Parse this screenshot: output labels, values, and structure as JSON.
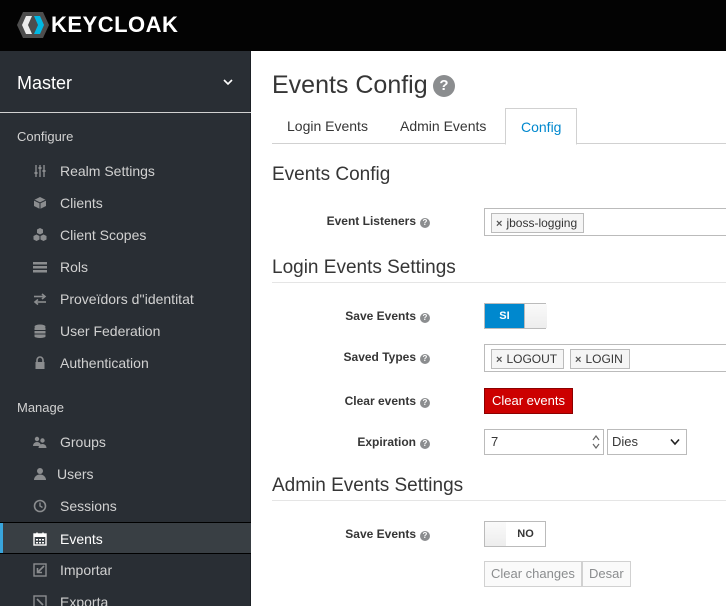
{
  "header": {
    "brand": "KEYCLOAK"
  },
  "sidebar": {
    "realm": "Master",
    "configure_label": "Configure",
    "manage_label": "Manage",
    "configure_items": [
      {
        "label": "Realm Settings",
        "icon": "sliders-icon"
      },
      {
        "label": "Clients",
        "icon": "cube-icon"
      },
      {
        "label": "Client Scopes",
        "icon": "cubes-icon"
      },
      {
        "label": "Rols",
        "icon": "list-icon"
      },
      {
        "label": "Proveïdors d''identitat",
        "icon": "exchange-icon"
      },
      {
        "label": "User Federation",
        "icon": "database-icon"
      },
      {
        "label": "Authentication",
        "icon": "lock-icon"
      }
    ],
    "manage_items": [
      {
        "label": "Groups",
        "icon": "users-icon"
      },
      {
        "label": "Users",
        "icon": "user-icon"
      },
      {
        "label": "Sessions",
        "icon": "clock-icon"
      },
      {
        "label": "Events",
        "icon": "calendar-icon",
        "active": true
      },
      {
        "label": "Importar",
        "icon": "import-icon"
      },
      {
        "label": "Exporta",
        "icon": "export-icon"
      }
    ]
  },
  "main": {
    "title": "Events Config",
    "tabs": [
      {
        "label": "Login Events"
      },
      {
        "label": "Admin Events"
      },
      {
        "label": "Config",
        "active": true
      }
    ],
    "events_config_title": "Events Config",
    "event_listeners_label": "Event Listeners",
    "event_listeners": [
      "jboss-logging"
    ],
    "login_settings_title": "Login Events Settings",
    "login_save_events_label": "Save Events",
    "login_save_events_state": "SI",
    "saved_types_label": "Saved Types",
    "saved_types": [
      "LOGOUT",
      "LOGIN"
    ],
    "clear_events_label": "Clear events",
    "clear_events_button": "Clear events",
    "expiration_label": "Expiration",
    "expiration_value": "7",
    "expiration_unit": "Dies",
    "admin_settings_title": "Admin Events Settings",
    "admin_save_events_label": "Save Events",
    "admin_save_events_state": "NO",
    "clear_changes_button": "Clear changes",
    "cancel_button": "Desar"
  },
  "colors": {
    "accent": "#0088ce",
    "danger": "#cc0000",
    "sidebar_bg": "#292e34"
  }
}
